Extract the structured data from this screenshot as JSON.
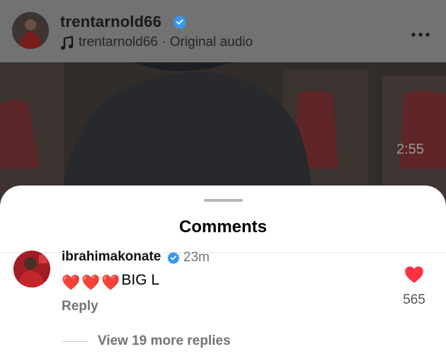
{
  "post": {
    "username": "trentarnold66",
    "audio_owner": "trentarnold66",
    "audio_separator": " · ",
    "audio_label": "Original audio",
    "video_time": "2:55"
  },
  "sheet": {
    "title": "Comments"
  },
  "comment": {
    "username": "ibrahimakonate",
    "time": "23m",
    "emojis": [
      "❤️",
      "❤️",
      "❤️"
    ],
    "text": "BIG L",
    "reply_label": "Reply",
    "like_count": "565",
    "liked": true,
    "view_replies_label": "View 19 more replies"
  },
  "icons": {
    "verified": "verified-badge-icon",
    "music": "music-note-icon",
    "more": "more-options-icon",
    "like": "heart-icon"
  },
  "colors": {
    "verified": "#3897f0",
    "like": "#ff3040",
    "secondary_text": "#737373"
  }
}
